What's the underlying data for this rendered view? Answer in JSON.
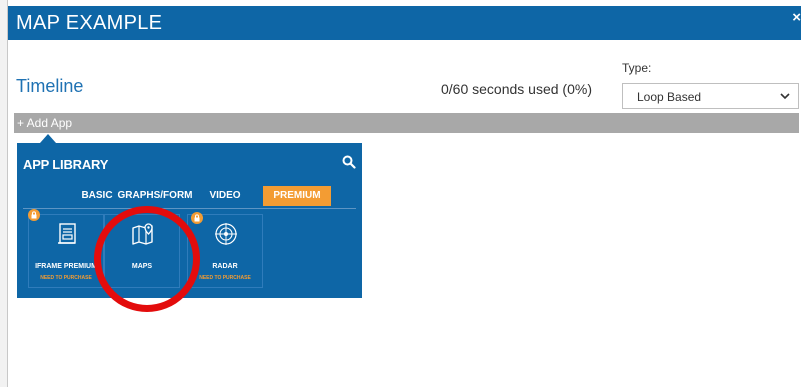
{
  "modal": {
    "title": "MAP EXAMPLE",
    "close_label": "×"
  },
  "timeline": {
    "title": "Timeline",
    "seconds_used": "0/60 seconds used (0%)"
  },
  "type": {
    "label": "Type:",
    "selected": "Loop Based"
  },
  "add_app": {
    "label": "+ Add App"
  },
  "library": {
    "title": "APP LIBRARY",
    "tabs": [
      {
        "label": "BASIC",
        "active": false
      },
      {
        "label": "GRAPHS/FORM",
        "active": false
      },
      {
        "label": "VIDEO",
        "active": false
      },
      {
        "label": "PREMIUM",
        "active": true
      }
    ],
    "apps": [
      {
        "name": "IFRAME PREMIUM",
        "note": "NEED TO PURCHASE",
        "icon": "iframe-icon",
        "locked": true
      },
      {
        "name": "MAPS",
        "note": "",
        "icon": "map-icon",
        "locked": false
      },
      {
        "name": "RADAR",
        "note": "NEED TO PURCHASE",
        "icon": "radar-icon",
        "locked": true
      }
    ]
  },
  "colors": {
    "primary": "#0e66a6",
    "accent": "#f39c33",
    "highlight": "#e30c0c",
    "bar": "#a8a8a8"
  }
}
